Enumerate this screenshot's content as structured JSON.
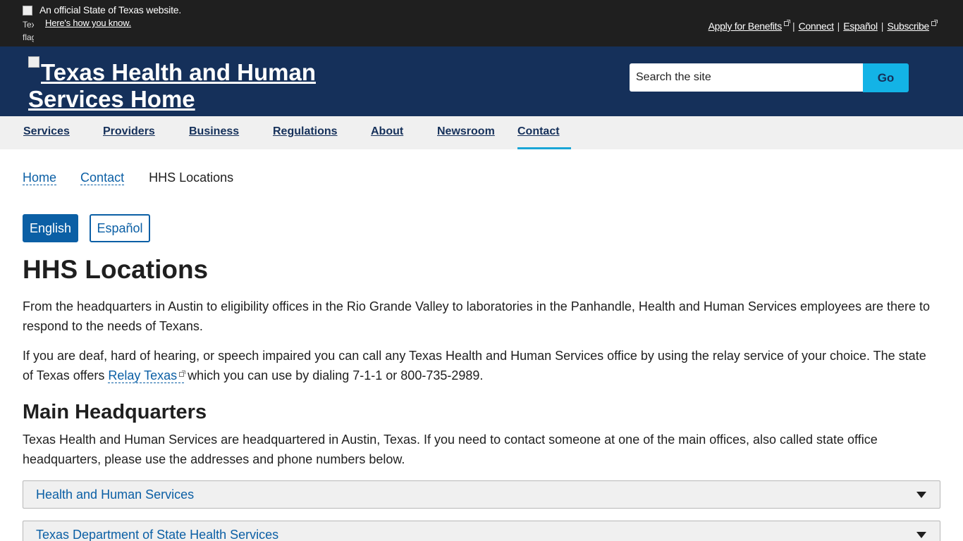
{
  "top_banner": {
    "flag_alt": "Texas flag",
    "official": "An official State of Texas website.",
    "how_know": "Here's how you know.",
    "links": [
      {
        "label": "Apply for Benefits",
        "external": true
      },
      {
        "label": "Connect",
        "external": false
      },
      {
        "label": "Español",
        "external": false
      },
      {
        "label": "Subscribe",
        "external": true
      }
    ]
  },
  "header": {
    "logo_alt": "Texas Health and Human Services Home",
    "search_placeholder": "Search the site",
    "go_label": "Go"
  },
  "nav": {
    "items": [
      "Services",
      "Providers",
      "Business",
      "Regulations",
      "About",
      "Newsroom",
      "Contact"
    ],
    "active": "Contact"
  },
  "breadcrumb": {
    "items": [
      "Home",
      "Contact"
    ],
    "current": "HHS Locations"
  },
  "language": {
    "english": "English",
    "spanish": "Español"
  },
  "main": {
    "title": "HHS Locations",
    "intro": "From the headquarters in Austin to eligibility offices in the Rio Grande Valley to laboratories in the Panhandle, Health and Human Services employees are there to respond to the needs of Texans.",
    "relay_before": "If you are deaf, hard of hearing, or speech impaired you can call any Texas Health and Human Services office by using the relay service of your choice. The state of Texas offers ",
    "relay_link": "Relay Texas",
    "relay_after": " which you can use by dialing 7-1-1 or 800-735-2989.",
    "hq_title": "Main Headquarters",
    "hq_text": "Texas Health and Human Services are headquartered in Austin, Texas. If you need to contact someone at one of the main offices, also called state office headquarters, please use the addresses and phone numbers below.",
    "accordions": [
      "Health and Human Services",
      "Texas Department of State Health Services"
    ]
  }
}
